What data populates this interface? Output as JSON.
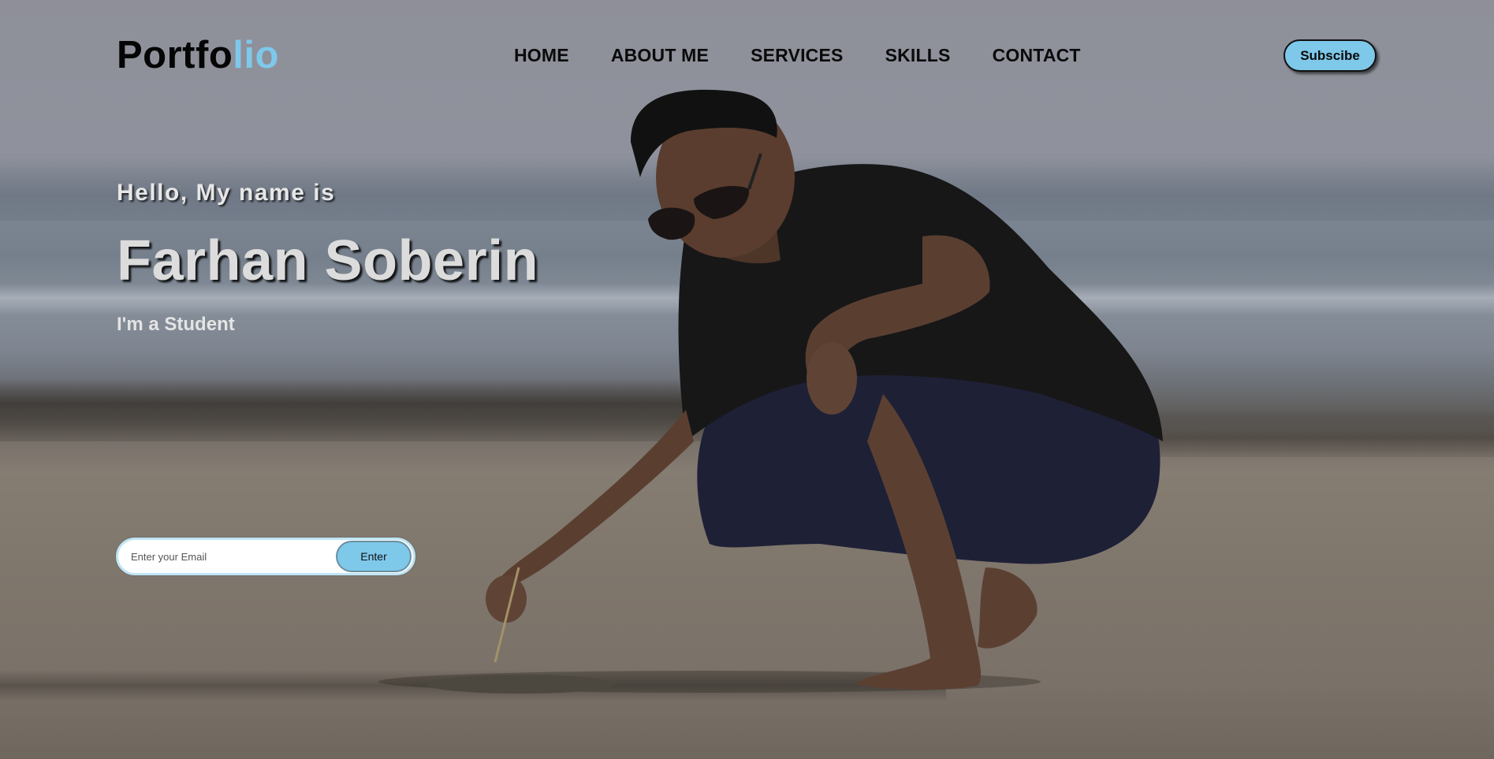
{
  "navbar": {
    "logo_main": "Portfo",
    "logo_accent": "lio",
    "links": [
      {
        "label": "HOME"
      },
      {
        "label": "ABOUT ME"
      },
      {
        "label": "SERVICES"
      },
      {
        "label": "SKILLS"
      },
      {
        "label": "CONTACT"
      }
    ],
    "subscribe_label": "Subscibe"
  },
  "hero": {
    "greeting": "Hello, My name is",
    "name": "Farhan Soberin",
    "role": "I'm a Student"
  },
  "email_form": {
    "placeholder": "Enter your Email",
    "value": "",
    "button_label": "Enter"
  },
  "colors": {
    "accent": "#7ec8ea",
    "nav_text": "#0a0a0a",
    "hero_text": "#dcdcdc"
  }
}
